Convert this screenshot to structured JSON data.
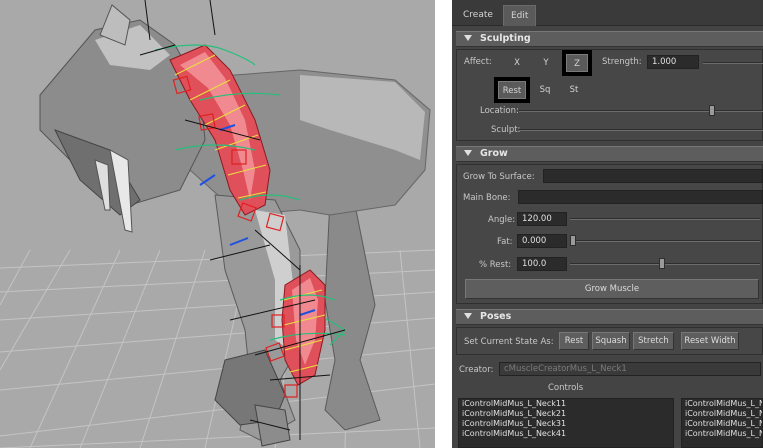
{
  "tabs": [
    {
      "label": "Create"
    },
    {
      "label": "Edit"
    }
  ],
  "sculpting": {
    "title": "Sculpting",
    "affect_label": "Affect:",
    "axes": [
      "X",
      "Y",
      "Z"
    ],
    "selected_axis": "Z",
    "strength_label": "Strength:",
    "strength_value": "1.000",
    "modes": [
      "Rest",
      "Sq",
      "St"
    ],
    "selected_mode": "Rest",
    "location_label": "Location:",
    "location_value": 0.8,
    "sculpt_label": "Sculpt:"
  },
  "grow": {
    "title": "Grow",
    "surface_label": "Grow To Surface:",
    "surface_value": "",
    "main_bone_label": "Main Bone:",
    "main_bone_value": "",
    "angle_label": "Angle:",
    "angle_value": "120.00",
    "fat_label": "Fat:",
    "fat_value": "0.000",
    "rest_label": "% Rest:",
    "rest_value": "100.0",
    "grow_button": "Grow Muscle"
  },
  "poses": {
    "title": "Poses",
    "set_state_label": "Set Current State As:",
    "buttons": [
      "Rest",
      "Squash",
      "Stretch",
      "Reset Width"
    ]
  },
  "creator": {
    "label": "Creator:",
    "value": "cMuscleCreatorMus_L_Neck1"
  },
  "controls": {
    "title": "Controls",
    "left_list": [
      "iControlMidMus_L_Neck11",
      "iControlMidMus_L_Neck21",
      "iControlMidMus_L_Neck31",
      "iControlMidMus_L_Neck41"
    ],
    "right_list": [
      "iControlMidMus_L_N",
      "iControlMidMus_L_N",
      "iControlMidMus_L_N",
      "iControlMidMus_L_N"
    ]
  },
  "colors": {
    "panel_bg": "#444444",
    "header_bg": "#5d5d5d",
    "viewport_bg": "#a8a8a8",
    "muscle": "#e0505a",
    "control_green": "#22c07a",
    "control_red": "#e02020",
    "control_blue": "#2050e0"
  }
}
